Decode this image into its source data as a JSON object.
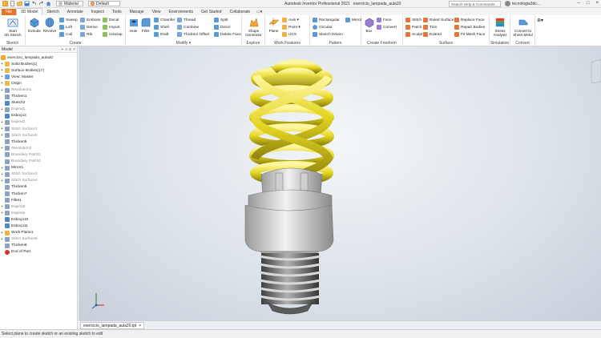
{
  "title": {
    "app": "Autodesk Inventor Professional 2021",
    "document": "exercicio_lampada_aula20"
  },
  "qat": {
    "material": "Material",
    "appearance": "Default"
  },
  "search": {
    "placeholder": "Search Help & Commands..."
  },
  "user": {
    "name": "tecnologia3dc..."
  },
  "tabs": [
    "File",
    "3D Model",
    "Sketch",
    "Annotate",
    "Inspect",
    "Tools",
    "Manage",
    "View",
    "Environments",
    "Get Started",
    "Collaborate"
  ],
  "ribbon": {
    "sketch": {
      "label": "Sketch",
      "start": "Start\n2D Sketch"
    },
    "create": {
      "label": "Create",
      "extrude": "Extrude",
      "revolve": "Revolve",
      "sweep": "Sweep",
      "loft": "Loft",
      "coil": "Coil",
      "emboss": "Emboss",
      "derive": "Derive",
      "rib": "Rib",
      "decal": "Decal",
      "import": "Import",
      "unwrap": "Unwrap"
    },
    "modify": {
      "label": "Modify ▾",
      "hole": "Hole",
      "fillet": "Fillet",
      "chamfer": "Chamfer",
      "shell": "Shell",
      "draft": "Draft",
      "thread": "Thread",
      "combine": "Combine",
      "thicken": "Thicken/ Offset",
      "split": "Split",
      "direct": "Direct",
      "delete_face": "Delete Face"
    },
    "explore": {
      "label": "Explore",
      "shape": "Shape\nGenerator"
    },
    "work": {
      "label": "Work Features",
      "plane": "Plane",
      "axis": "Axis ▾",
      "point": "Point ▾",
      "ucs": "UCS"
    },
    "pattern": {
      "label": "Pattern",
      "rectangular": "Rectangular",
      "circular": "Circular",
      "sketch_driven": "Sketch Driven",
      "mirror": "Mirror"
    },
    "freeform": {
      "label": "Create Freeform",
      "box": "Box",
      "face": "Face",
      "convert": "Convert"
    },
    "surface": {
      "label": "Surface",
      "stitch": "Stitch",
      "patch": "Patch",
      "sculpt": "Sculpt",
      "ruled": "Ruled Surface",
      "trim": "Trim",
      "extend": "Extend",
      "replace": "Replace Face",
      "repair": "Repair Bodies",
      "fitmesh": "Fit Mesh Face"
    },
    "simulation": {
      "label": "Simulation",
      "stress": "Stress\nAnalysis"
    },
    "convert": {
      "label": "Convert",
      "sheet": "Convert to\nSheet Metal"
    }
  },
  "browser": {
    "title": "Model",
    "root": "exercicio_lampada_aula20",
    "items": [
      {
        "label": "Solid Bodies(1)",
        "icon": "folder",
        "exp": "+"
      },
      {
        "label": "Surface Bodies(17)",
        "icon": "folder",
        "exp": "+"
      },
      {
        "label": "View: Master",
        "icon": "view",
        "exp": "+"
      },
      {
        "label": "Origin",
        "icon": "folder",
        "exp": "+"
      },
      {
        "label": "Revolution1",
        "icon": "feature",
        "exp": "+",
        "dim": true
      },
      {
        "label": "Thicken1",
        "icon": "feature",
        "exp": ""
      },
      {
        "label": "Sketch2",
        "icon": "sketch",
        "exp": ""
      },
      {
        "label": "Espiral1",
        "icon": "feature",
        "exp": "+",
        "dim": true
      },
      {
        "label": "Esboço3",
        "icon": "sketch",
        "exp": ""
      },
      {
        "label": "Espiral2",
        "icon": "feature",
        "exp": "+",
        "dim": true
      },
      {
        "label": "Stitch Surface1",
        "icon": "feature",
        "exp": "+",
        "dim": true
      },
      {
        "label": "Stitch Surface2",
        "icon": "feature",
        "exp": "+",
        "dim": true
      },
      {
        "label": "Thicken5",
        "icon": "feature",
        "exp": ""
      },
      {
        "label": "Revolution2",
        "icon": "feature",
        "exp": "+",
        "dim": true
      },
      {
        "label": "Boundary Patch1",
        "icon": "feature",
        "exp": "",
        "dim": true
      },
      {
        "label": "Boundary Patch2",
        "icon": "feature",
        "exp": "",
        "dim": true
      },
      {
        "label": "Mirror1",
        "icon": "feature",
        "exp": "+"
      },
      {
        "label": "Stitch Surface3",
        "icon": "feature",
        "exp": "+",
        "dim": true
      },
      {
        "label": "Stitch Surface4",
        "icon": "feature",
        "exp": "+",
        "dim": true
      },
      {
        "label": "Thicken6",
        "icon": "feature",
        "exp": ""
      },
      {
        "label": "Thicken7",
        "icon": "feature",
        "exp": ""
      },
      {
        "label": "Fillet1",
        "icon": "feature",
        "exp": ""
      },
      {
        "label": "Espiral3",
        "icon": "feature",
        "exp": "+",
        "dim": true
      },
      {
        "label": "Espiral4",
        "icon": "feature",
        "exp": "+",
        "dim": true
      },
      {
        "label": "Esboço10",
        "icon": "sketch",
        "exp": ""
      },
      {
        "label": "Esboço11",
        "icon": "sketch",
        "exp": ""
      },
      {
        "label": "Work Plane1",
        "icon": "plane",
        "exp": "+"
      },
      {
        "label": "Stitch Surface5",
        "icon": "feature",
        "exp": "+",
        "dim": true
      },
      {
        "label": "Thicken8",
        "icon": "feature",
        "exp": ""
      },
      {
        "label": "End of Part",
        "icon": "end",
        "exp": ""
      }
    ]
  },
  "document_tab": {
    "label": "exercicio_lampada_aula20.ipt",
    "close": "×"
  },
  "status": {
    "text": "Select plane to create sketch or an existing sketch to edit"
  },
  "colors": {
    "file_tab": "#e8742a",
    "bulb_yellow": "#e3d420",
    "base_gray": "#d4d4d4"
  }
}
